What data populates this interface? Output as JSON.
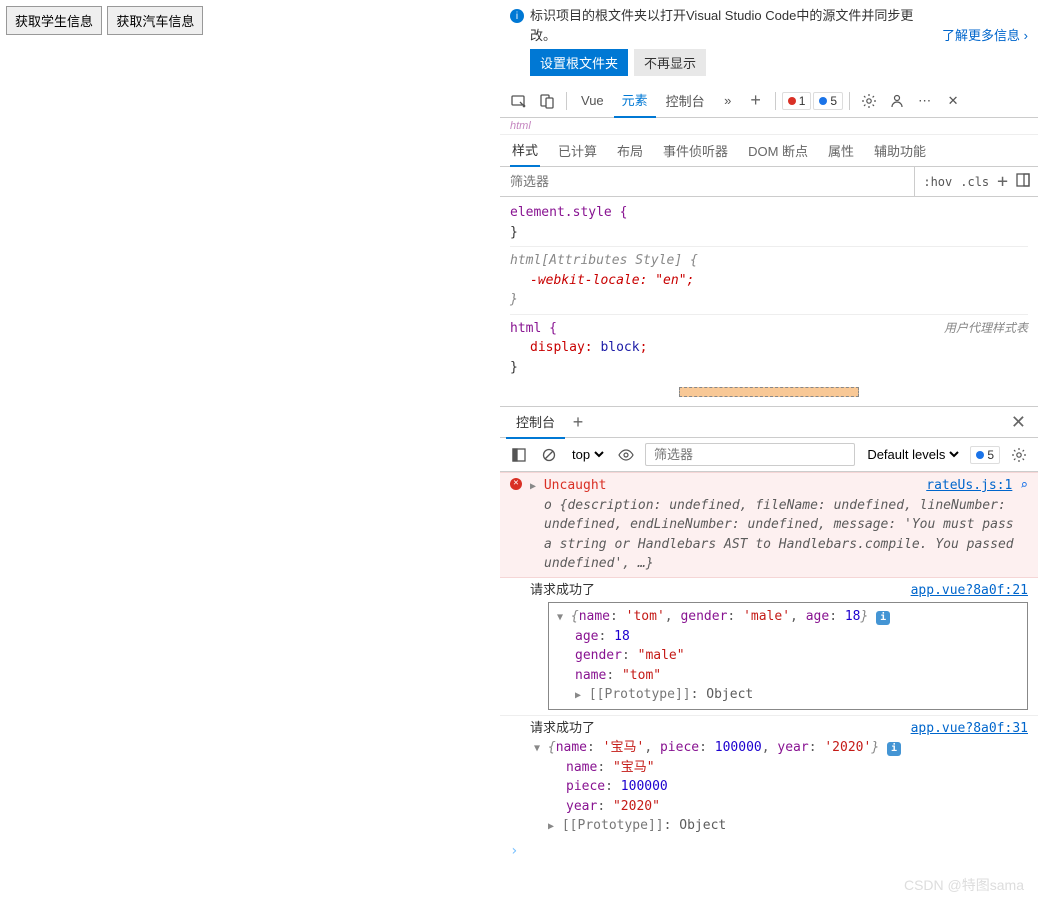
{
  "leftButtons": {
    "student": "获取学生信息",
    "car": "获取汽车信息"
  },
  "infobar": {
    "text": "标识项目的根文件夹以打开Visual Studio Code中的源文件并同步更改。",
    "link": "了解更多信息",
    "setRoot": "设置根文件夹",
    "dismiss": "不再显示"
  },
  "toolbar": {
    "tabs": {
      "vue": "Vue",
      "elements": "元素",
      "console": "控制台"
    },
    "errorCount": "1",
    "infoCount": "5",
    "chevron": "»"
  },
  "htmlTag": "html",
  "subtabs": {
    "styles": "样式",
    "computed": "已计算",
    "layout": "布局",
    "listeners": "事件侦听器",
    "domBreak": "DOM 断点",
    "props": "属性",
    "a11y": "辅助功能"
  },
  "filter": {
    "placeholder": "筛选器",
    "hov": ":hov",
    "cls": ".cls"
  },
  "styles": {
    "elStyle": "element.style {",
    "close": "}",
    "attrSel": "html[Attributes Style] {",
    "webkitProp": "-webkit-locale",
    "webkitVal": "\"en\"",
    "htmlSel": "html {",
    "displayProp": "display",
    "displayVal": "block",
    "uaLabel": "用户代理样式表"
  },
  "consoleTabs": {
    "console": "控制台"
  },
  "consoleToolbar": {
    "top": "top",
    "filterPlaceholder": "筛选器",
    "levels": "Default levels",
    "infoCount": "5"
  },
  "logs": {
    "error": {
      "title": "Uncaught",
      "body": "o {description: undefined, fileName: undefined, lineNumber: undefined, endLineNumber: undefined, message: 'You must pass a string or Handlebars AST to Handlebars.compile. You passed undefined', …}",
      "link": "rateUs.js:1"
    },
    "l1": {
      "msg": "请求成功了",
      "link": "app.vue?8a0f:21",
      "summary": "{name: 'tom', gender: 'male', age: 18}",
      "ageK": "age",
      "ageV": "18",
      "genderK": "gender",
      "genderV": "\"male\"",
      "nameK": "name",
      "nameV": "\"tom\"",
      "proto": "[[Prototype]]",
      "protoV": "Object"
    },
    "l2": {
      "msg": "请求成功了",
      "link": "app.vue?8a0f:31",
      "summary": "{name: '宝马', piece: 100000, year: '2020'}",
      "nameK": "name",
      "nameV": "\"宝马\"",
      "pieceK": "piece",
      "pieceV": "100000",
      "yearK": "year",
      "yearV": "\"2020\"",
      "proto": "[[Prototype]]",
      "protoV": "Object"
    }
  },
  "watermark": "CSDN @特图sama"
}
